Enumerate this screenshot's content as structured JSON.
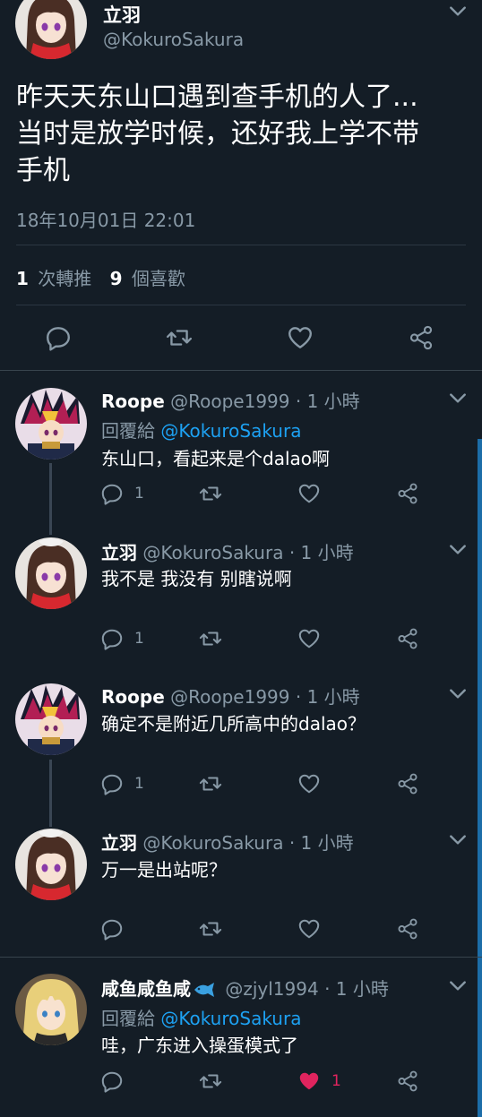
{
  "main_tweet": {
    "author_name": "立羽",
    "author_handle": "@KokuroSakura",
    "text_lines": [
      "昨天天东山口遇到查手机的人了...",
      "当时是放学时候，还好我上学不带",
      "手机"
    ],
    "timestamp": "18年10月01日 22:01",
    "retweet_count": "1",
    "retweet_label": "次轉推",
    "like_count": "9",
    "like_label": "個喜歡"
  },
  "replies": [
    {
      "name": "Roope",
      "handle": "@Roope1999",
      "time": "· 1 小時",
      "reply_to_label": "回覆給",
      "reply_to_handle": "@KokuroSakura",
      "text": "东山口，看起来是个dalao啊",
      "reply_count": "1",
      "like_count": ""
    },
    {
      "name": "立羽",
      "handle": "@KokuroSakura",
      "time": "· 1 小時",
      "text": "我不是 我没有 别瞎说啊",
      "reply_count": "1",
      "like_count": ""
    },
    {
      "name": "Roope",
      "handle": "@Roope1999",
      "time": "· 1 小時",
      "text": "确定不是附近几所高中的dalao？",
      "reply_count": "1",
      "like_count": ""
    },
    {
      "name": "立羽",
      "handle": "@KokuroSakura",
      "time": "· 1 小時",
      "text": "万一是出站呢？",
      "reply_count": "",
      "like_count": ""
    },
    {
      "name": "咸鱼咸鱼咸",
      "handle": "@zjyl1994",
      "time": "· 1 小時",
      "reply_to_label": "回覆給",
      "reply_to_handle": "@KokuroSakura",
      "text": "哇，广东进入操蛋模式了",
      "reply_count": "",
      "like_count": "1"
    }
  ],
  "colors": {
    "background": "#141d26",
    "muted": "#8899a6",
    "link": "#1da1f2",
    "liked": "#e0245e",
    "divider": "#2b3642"
  },
  "icons": [
    "reply-icon",
    "retweet-icon",
    "heart-icon",
    "share-icon",
    "chevron-down-icon",
    "fish-emoji-icon"
  ]
}
